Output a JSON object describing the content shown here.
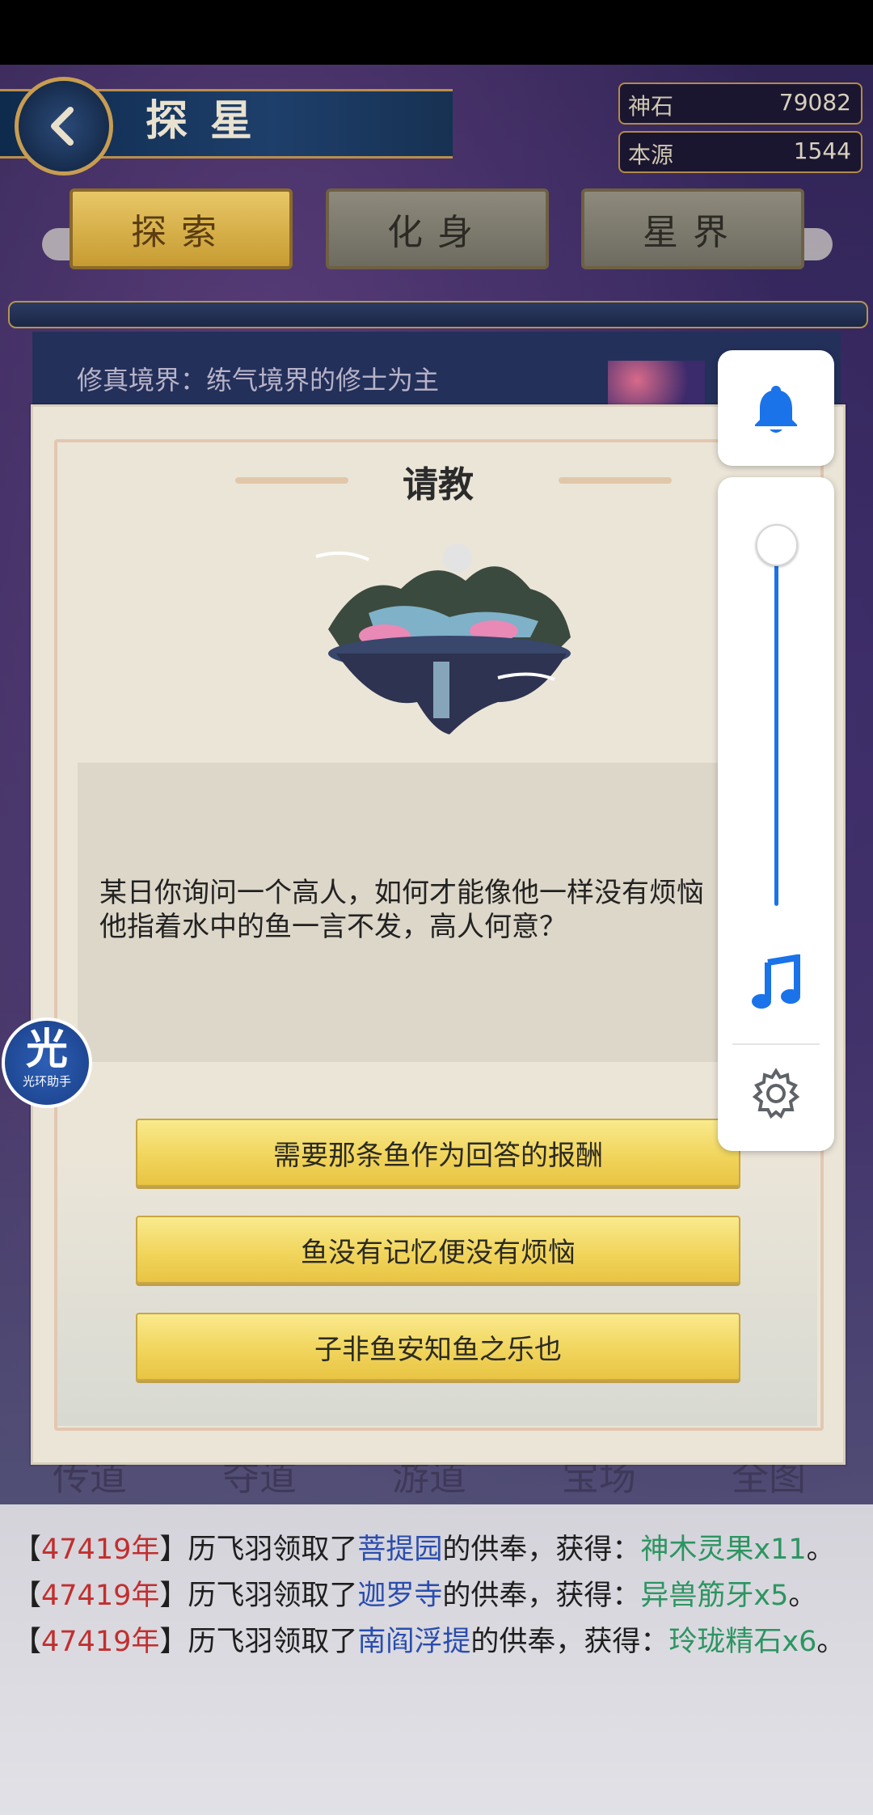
{
  "header": {
    "title": "探星",
    "resources": [
      {
        "label": "神石",
        "value": "79082"
      },
      {
        "label": "本源",
        "value": "1544"
      }
    ]
  },
  "tabs": [
    {
      "label": "探索",
      "active": true
    },
    {
      "label": "化身",
      "active": false
    },
    {
      "label": "星界",
      "active": false
    }
  ],
  "realm_text": "修真境界：练气境界的修士为主",
  "dialog": {
    "title": "请教",
    "question_line1": "某日你询问一个高人，如何才能像他一样没有烦恼",
    "question_line2": "他指着水中的鱼一言不发，高人何意？",
    "options": [
      "需要那条鱼作为回答的报酬",
      "鱼没有记忆便没有烦恼",
      "子非鱼安知鱼之乐也"
    ]
  },
  "bottom_tabs": [
    "传道",
    "夺道",
    "游道",
    "宝场",
    "全图"
  ],
  "log": [
    {
      "year": "47419年",
      "actor": "历飞羽领取了",
      "place": "菩提园",
      "mid": "的供奉，获得：",
      "reward": "神木灵果x11",
      "end": "。"
    },
    {
      "year": "47419年",
      "actor": "历飞羽领取了",
      "place": "迦罗寺",
      "mid": "的供奉，获得：",
      "reward": "异兽筋牙x5",
      "end": "。"
    },
    {
      "year": "47419年",
      "actor": "历飞羽领取了",
      "place": "南阎浮提",
      "mid": "的供奉，获得：",
      "reward": "玲珑精石x6",
      "end": "。"
    }
  ],
  "helper": {
    "char": "光",
    "label": "光环助手"
  },
  "colors": {
    "volume_accent": "#1a73e8",
    "option_gold": "#f1d55c",
    "log_year_red": "#c12f2f",
    "log_place_blue": "#2a4dae",
    "log_reward_green": "#2c9561"
  },
  "volume_panel": {
    "icons": [
      "bell-icon",
      "music-note-icon",
      "settings-gear-icon"
    ],
    "level": 0.0
  }
}
